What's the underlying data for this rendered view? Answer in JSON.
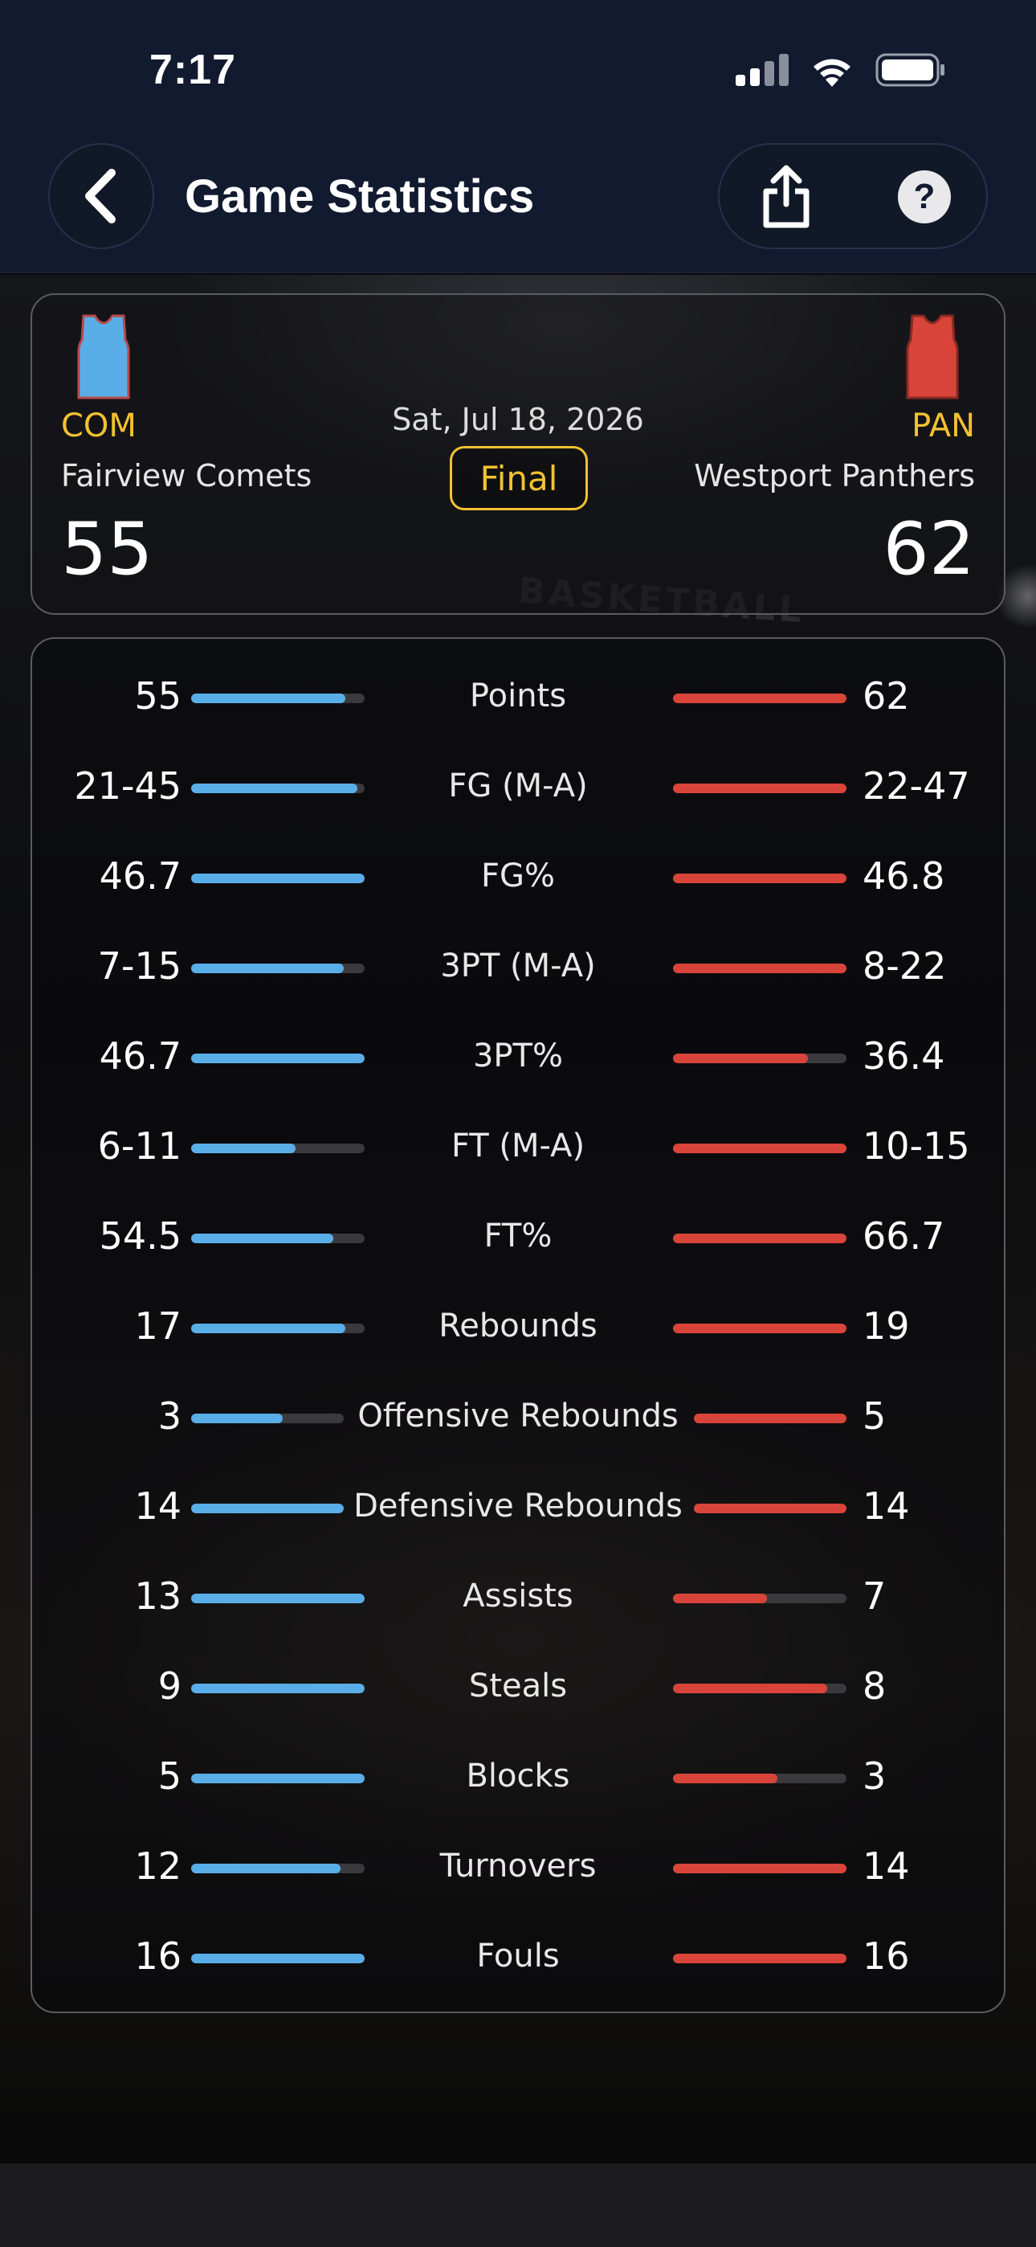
{
  "status_bar": {
    "time": "7:17"
  },
  "header": {
    "title": "Game Statistics"
  },
  "game": {
    "date": "Sat, Jul 18, 2026",
    "status": "Final"
  },
  "home": {
    "abbr": "COM",
    "name": "Fairview Comets",
    "score": "55",
    "color": "#5aaee8"
  },
  "away": {
    "abbr": "PAN",
    "name": "Westport Panthers",
    "score": "62",
    "color": "#d9443a"
  },
  "stats": [
    {
      "label": "Points",
      "home": "55",
      "away": "62",
      "home_fill": 0.89,
      "away_fill": 1.0
    },
    {
      "label": "FG (M-A)",
      "home": "21-45",
      "away": "22-47",
      "home_fill": 0.96,
      "away_fill": 1.0
    },
    {
      "label": "FG%",
      "home": "46.7",
      "away": "46.8",
      "home_fill": 1.0,
      "away_fill": 1.0
    },
    {
      "label": "3PT (M-A)",
      "home": "7-15",
      "away": "8-22",
      "home_fill": 0.88,
      "away_fill": 1.0
    },
    {
      "label": "3PT%",
      "home": "46.7",
      "away": "36.4",
      "home_fill": 1.0,
      "away_fill": 0.78
    },
    {
      "label": "FT (M-A)",
      "home": "6-11",
      "away": "10-15",
      "home_fill": 0.6,
      "away_fill": 1.0
    },
    {
      "label": "FT%",
      "home": "54.5",
      "away": "66.7",
      "home_fill": 0.82,
      "away_fill": 1.0
    },
    {
      "label": "Rebounds",
      "home": "17",
      "away": "19",
      "home_fill": 0.89,
      "away_fill": 1.0
    },
    {
      "label": "Offensive Rebounds",
      "home": "3",
      "away": "5",
      "home_fill": 0.6,
      "away_fill": 1.0
    },
    {
      "label": "Defensive Rebounds",
      "home": "14",
      "away": "14",
      "home_fill": 1.0,
      "away_fill": 1.0
    },
    {
      "label": "Assists",
      "home": "13",
      "away": "7",
      "home_fill": 1.0,
      "away_fill": 0.54
    },
    {
      "label": "Steals",
      "home": "9",
      "away": "8",
      "home_fill": 1.0,
      "away_fill": 0.89
    },
    {
      "label": "Blocks",
      "home": "5",
      "away": "3",
      "home_fill": 1.0,
      "away_fill": 0.6
    },
    {
      "label": "Turnovers",
      "home": "12",
      "away": "14",
      "home_fill": 0.86,
      "away_fill": 1.0
    },
    {
      "label": "Fouls",
      "home": "16",
      "away": "16",
      "home_fill": 1.0,
      "away_fill": 1.0
    }
  ]
}
